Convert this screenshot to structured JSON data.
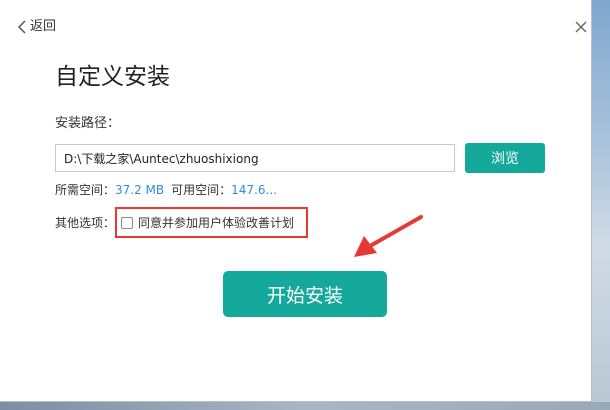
{
  "header": {
    "back_label": "返回"
  },
  "title": "自定义安装",
  "path": {
    "label": "安装路径：",
    "value": "D:\\下载之家\\Auntec\\zhuoshixiong",
    "browse_label": "浏览"
  },
  "space": {
    "required_label": "所需空间：",
    "required_value": "37.2 MB",
    "available_label": "可用空间：",
    "available_value": "147.6..."
  },
  "options": {
    "label": "其他选项：",
    "checkbox_label": "同意并参加用户体验改善计划",
    "checked": false
  },
  "start_label": "开始安装",
  "colors": {
    "accent": "#14a99a",
    "link": "#2f8ee0",
    "annotation": "#e53935"
  },
  "icons": {
    "back": "chevron-left-icon",
    "close": "close-icon",
    "annotation": "arrow-annotation-icon"
  }
}
